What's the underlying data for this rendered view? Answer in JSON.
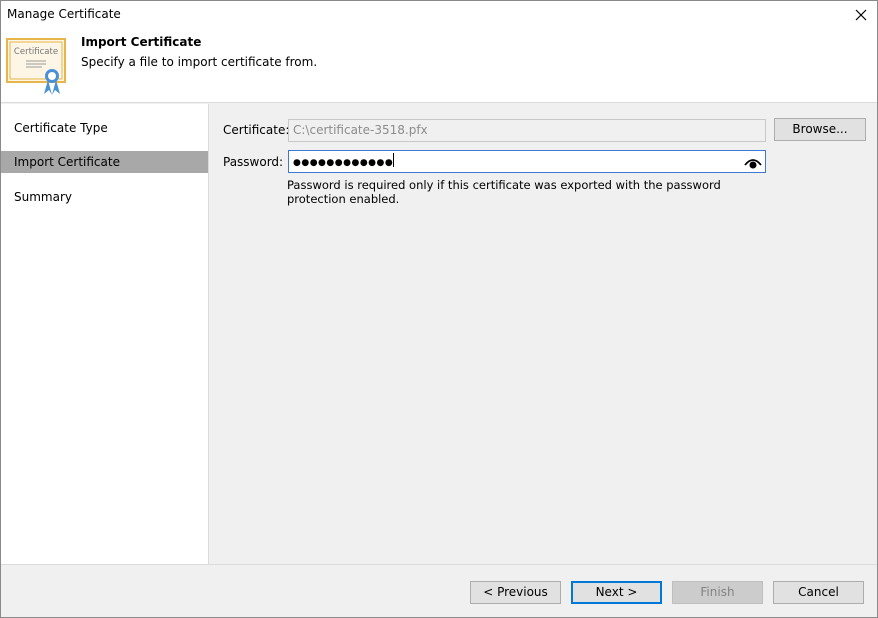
{
  "window": {
    "title": "Manage Certificate"
  },
  "header": {
    "title": "Import Certificate",
    "subtitle": "Specify a file to import certificate from.",
    "icon_text": "Certificate"
  },
  "nav": {
    "items": [
      {
        "label": "Certificate Type",
        "active": false
      },
      {
        "label": "Import Certificate",
        "active": true
      },
      {
        "label": "Summary",
        "active": false
      }
    ]
  },
  "form": {
    "certificate_label": "Certificate:",
    "certificate_value": "C:\\certificate-3518.pfx",
    "browse_label": "Browse...",
    "password_label": "Password:",
    "password_mask": "●●●●●●●●●●●●",
    "password_hint": "Password is required only if this certificate was exported with the password protection enabled."
  },
  "footer": {
    "previous_label": "< Previous",
    "next_label": "Next >",
    "finish_label": "Finish",
    "cancel_label": "Cancel"
  },
  "colors": {
    "accent": "#0078d7",
    "nav_active": "#a8a8a8",
    "icon_gold": "#e8b54a",
    "icon_blue": "#4a90d9"
  },
  "icons": {
    "close": "close-icon",
    "certificate": "certificate-icon",
    "eye": "eye-icon"
  }
}
